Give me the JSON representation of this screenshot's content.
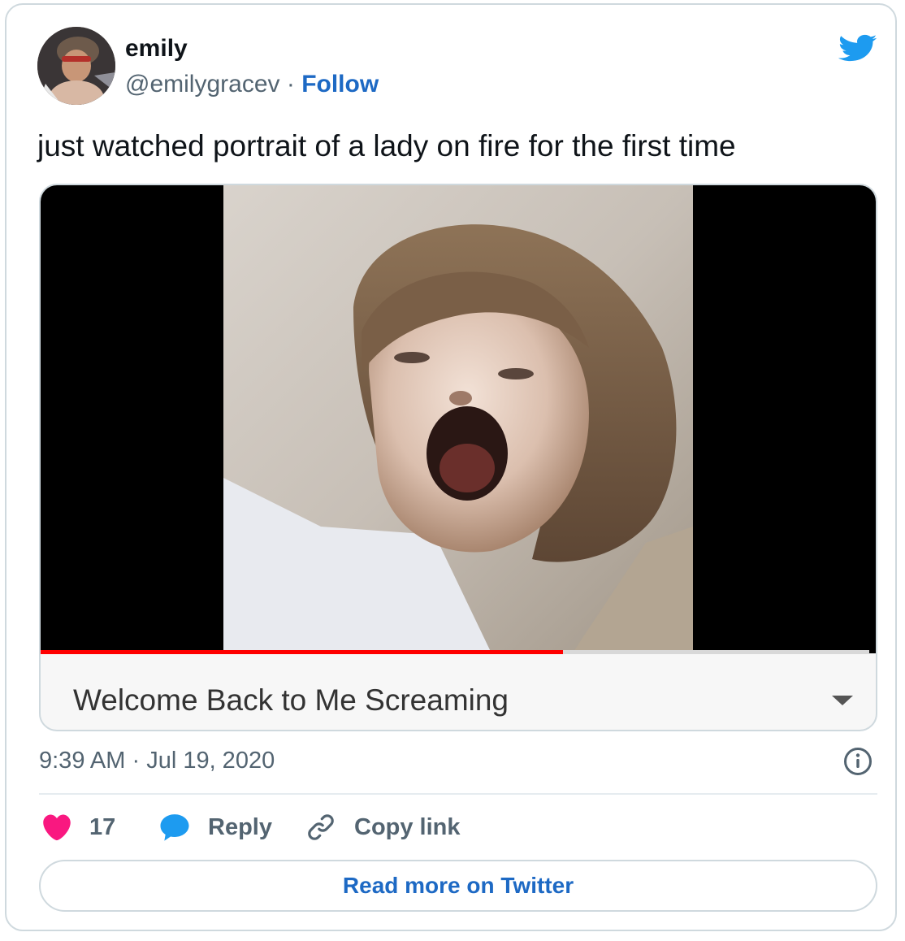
{
  "tweet": {
    "author": {
      "display_name": "emily",
      "handle": "@emilygracev",
      "separator": " · ",
      "follow_label": "Follow"
    },
    "text": "just watched portrait of a lady on fire for the first time",
    "media": {
      "caption": "Welcome Back to Me Screaming",
      "progress_fraction": 0.63
    },
    "time": "9:39 AM",
    "time_separator": " · ",
    "date": "Jul 19, 2020",
    "actions": {
      "like_count": "17",
      "reply_label": "Reply",
      "copy_link_label": "Copy link"
    },
    "read_more_label": "Read more on Twitter"
  },
  "colors": {
    "twitter_blue": "#1d9bf0",
    "link_blue": "#1d69c4",
    "like_pink": "#f91880",
    "progress_red": "#ff0000",
    "muted_text": "#536471"
  },
  "icons": {
    "brand": "twitter-bird-icon",
    "info": "info-icon",
    "like": "heart-icon",
    "reply": "speech-bubble-icon",
    "copy_link": "link-icon",
    "caption_toggle": "triangle-down-icon"
  }
}
